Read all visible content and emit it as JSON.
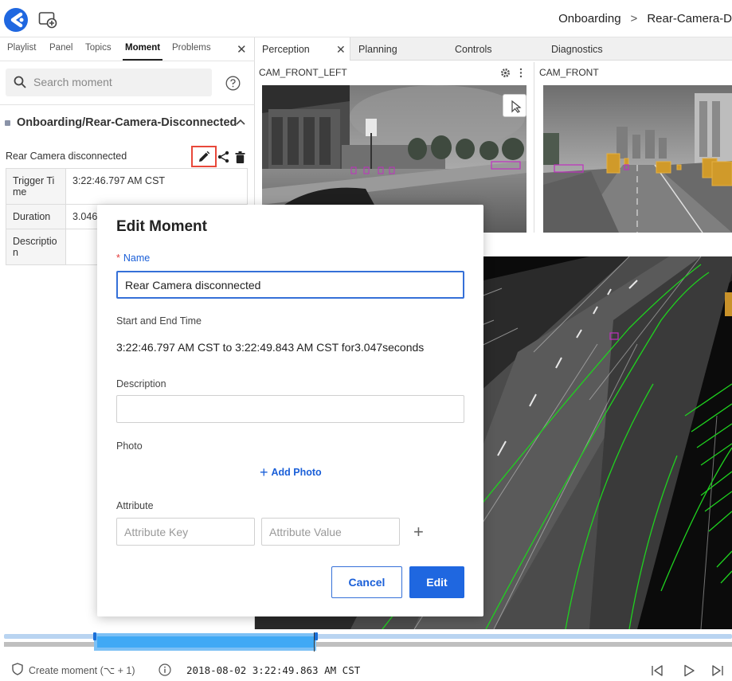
{
  "header": {
    "breadcrumb": [
      "Onboarding",
      "Rear-Camera-D"
    ],
    "separator": ">"
  },
  "left_panel": {
    "tabs": [
      "Playlist",
      "Panel",
      "Topics",
      "Moment",
      "Problems"
    ],
    "active_tab": "Moment",
    "close": "✕",
    "search": {
      "placeholder": "Search moment"
    },
    "moment_title": "Onboarding/Rear-Camera-Disconnected",
    "item": {
      "name": "Rear Camera disconnected",
      "rows": [
        {
          "key": "Trigger Time",
          "value": "3:22:46.797 AM CST"
        },
        {
          "key": "Duration",
          "value": "3.046"
        },
        {
          "key": "Description",
          "value": ""
        }
      ]
    }
  },
  "right_panel": {
    "tabs": [
      "Perception",
      "Planning",
      "Controls",
      "Diagnostics"
    ],
    "active_tab": "Perception",
    "close": "✕",
    "cameras": [
      "CAM_FRONT_LEFT",
      "CAM_FRONT"
    ]
  },
  "dialog": {
    "title": "Edit Moment",
    "name_label": "Name",
    "required_mark": "*",
    "name_value": "Rear Camera disconnected",
    "time_label": "Start and End Time",
    "time_value": "3:22:46.797 AM CST to 3:22:49.843 AM CST for3.047seconds",
    "description_label": "Description",
    "description_value": "",
    "photo_label": "Photo",
    "add_photo": "Add Photo",
    "attribute_label": "Attribute",
    "attribute_key_placeholder": "Attribute Key",
    "attribute_value_placeholder": "Attribute Value",
    "cancel": "Cancel",
    "submit": "Edit"
  },
  "timeline": {
    "selection_start_fraction": 0.124,
    "selection_end_fraction": 0.43
  },
  "status_bar": {
    "create_moment": "Create moment  (⌥ + 1)",
    "timestamp": "2018-08-02 3:22:49.863 AM CST"
  },
  "colors": {
    "accent": "#1f67e0",
    "highlight_border": "#e8483a",
    "timeline_selection": "#40a9f5"
  },
  "icons": [
    "app-logo-icon",
    "new-window-icon",
    "search-icon",
    "help-icon",
    "chevron-up-icon",
    "pencil-icon",
    "share-icon",
    "trash-icon",
    "gear-icon",
    "more-icon",
    "cursor-icon",
    "shield-icon",
    "info-icon",
    "skip-back-icon",
    "play-icon",
    "skip-forward-icon"
  ]
}
